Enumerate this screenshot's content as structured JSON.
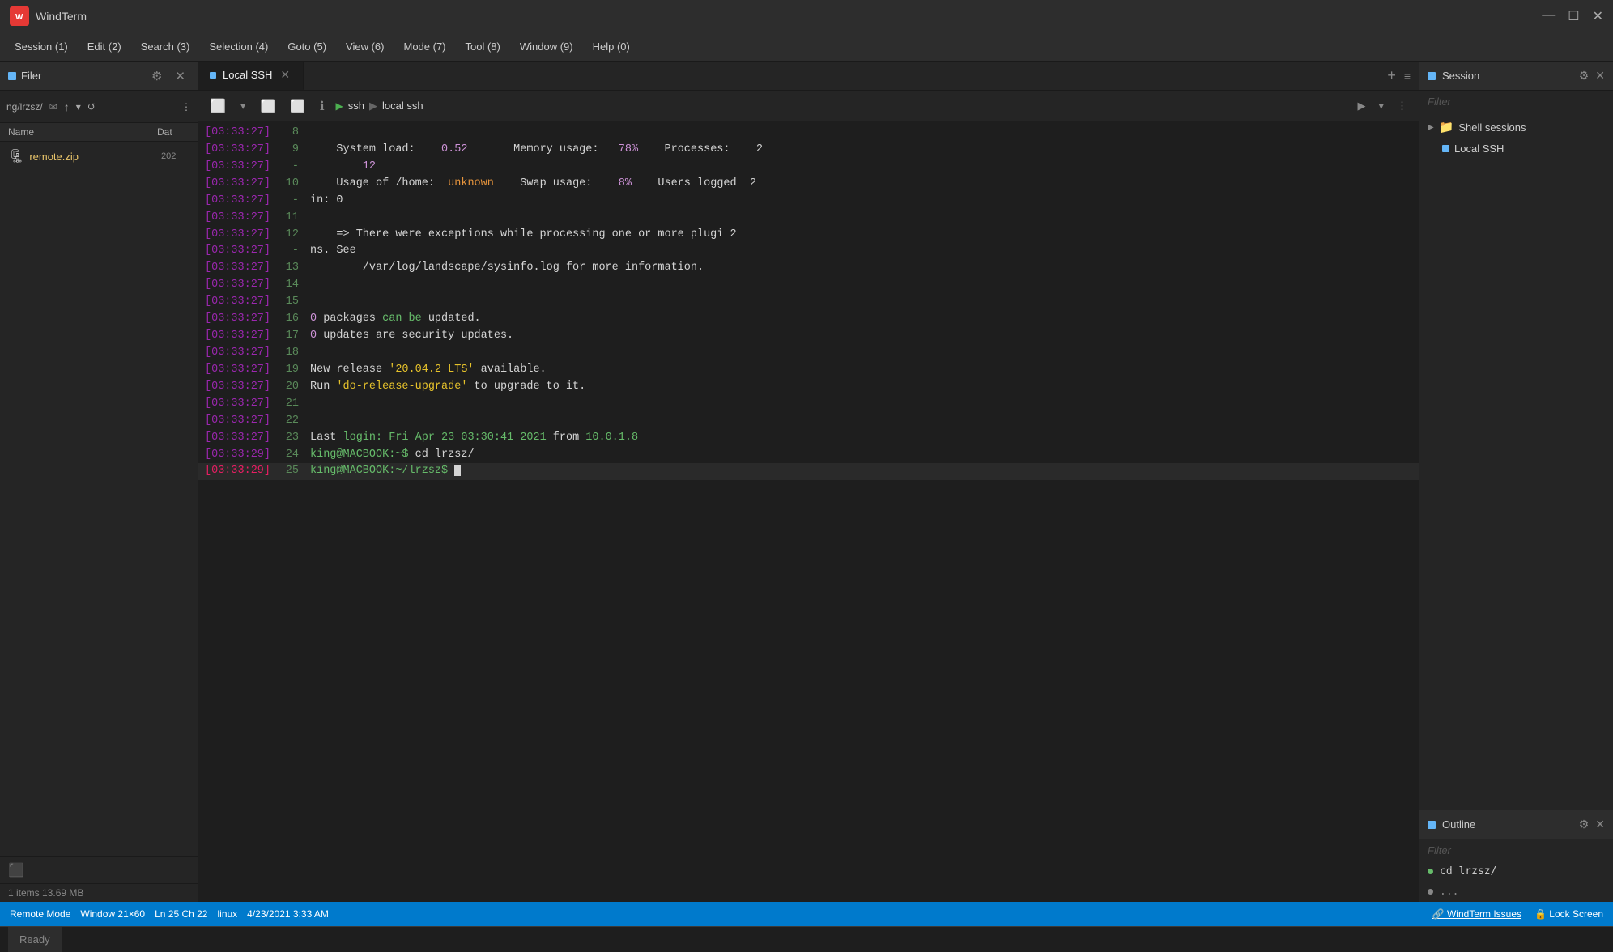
{
  "window": {
    "title": "WindTerm",
    "icon": "W"
  },
  "menu": {
    "items": [
      "Session (1)",
      "Edit (2)",
      "Search (3)",
      "Selection (4)",
      "Goto (5)",
      "View (6)",
      "Mode (7)",
      "Tool (8)",
      "Window (9)",
      "Help (0)"
    ]
  },
  "filer": {
    "tab_label": "Filer",
    "path": "ng/lrzsz/",
    "columns": {
      "name": "Name",
      "date": "Dat"
    },
    "items": [
      {
        "name": "remote.zip",
        "date": "202",
        "icon": "🗜"
      }
    ],
    "status": "1 items  13.69 MB"
  },
  "terminal": {
    "tab_label": "Local SSH",
    "breadcrumb": {
      "items": [
        "ssh",
        "local ssh"
      ]
    },
    "lines": [
      {
        "time": "[03:33:27]",
        "num": "8",
        "content": ""
      },
      {
        "time": "[03:33:27]",
        "num": "9",
        "content": "    System load:    0.52       Memory usage:   78%    Processes:    2"
      },
      {
        "time": "[03:33:27]",
        "num": "-",
        "content": "        12"
      },
      {
        "time": "[03:33:27]",
        "num": "10",
        "content": "    Usage of /home:  unknown    Swap usage:    8%    Users logged  2"
      },
      {
        "time": "[03:33:27]",
        "num": "-",
        "content": "in: 0"
      },
      {
        "time": "[03:33:27]",
        "num": "11",
        "content": ""
      },
      {
        "time": "[03:33:27]",
        "num": "12",
        "content": "    => There were exceptions while processing one or more plugi 2"
      },
      {
        "time": "[03:33:27]",
        "num": "-",
        "content": "ns. See"
      },
      {
        "time": "[03:33:27]",
        "num": "13",
        "content": "        /var/log/landscape/sysinfo.log for more information."
      },
      {
        "time": "[03:33:27]",
        "num": "14",
        "content": ""
      },
      {
        "time": "[03:33:27]",
        "num": "15",
        "content": ""
      },
      {
        "time": "[03:33:27]",
        "num": "16",
        "content": "0 packages can be updated."
      },
      {
        "time": "[03:33:27]",
        "num": "17",
        "content": "0 updates are security updates."
      },
      {
        "time": "[03:33:27]",
        "num": "18",
        "content": ""
      },
      {
        "time": "[03:33:27]",
        "num": "19",
        "content": "New release '20.04.2 LTS' available."
      },
      {
        "time": "[03:33:27]",
        "num": "20",
        "content": "Run 'do-release-upgrade' to upgrade to it."
      },
      {
        "time": "[03:33:27]",
        "num": "21",
        "content": ""
      },
      {
        "time": "[03:33:27]",
        "num": "22",
        "content": ""
      },
      {
        "time": "[03:33:27]",
        "num": "23",
        "content": "Last login: Fri Apr 23 03:30:41 2021 from 10.0.1.8"
      },
      {
        "time": "[03:33:29]",
        "num": "24",
        "content": "king@MACBOOK:~$ cd lrzsz/"
      },
      {
        "time": "[03:33:29]",
        "num": "25",
        "content": "king@MACBOOK:~/lrzsz$ ",
        "current": true
      }
    ]
  },
  "session": {
    "tab_label": "Session",
    "filter_placeholder": "Filter",
    "groups": [
      {
        "name": "Shell sessions",
        "items": [
          "Local SSH"
        ]
      }
    ]
  },
  "outline": {
    "tab_label": "Outline",
    "filter_placeholder": "Filter",
    "items": [
      {
        "label": "cd lrzsz/",
        "type": "green"
      },
      {
        "label": "...",
        "type": "gray"
      }
    ]
  },
  "statusbar": {
    "remote_mode": "Remote Mode",
    "window_size": "Window 21×60",
    "position": "Ln 25 Ch 22",
    "os": "linux",
    "datetime": "4/23/2021  3:33 AM",
    "issues_link": "WindTerm Issues",
    "lock": "Lock Screen"
  },
  "bottombar": {
    "ready": "Ready"
  }
}
